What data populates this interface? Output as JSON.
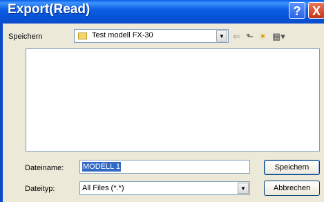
{
  "window": {
    "title": "Export(Read)"
  },
  "titlebar_buttons": {
    "help": "?",
    "close": "X"
  },
  "lookin": {
    "label": "Speichern",
    "value": "Test modell FX-30"
  },
  "toolbar": {
    "back": "⇐",
    "up": "⬑",
    "new_folder": "✶",
    "view_menu": "▦▾"
  },
  "filename": {
    "label": "Dateiname:",
    "value": "MODELL 1"
  },
  "filetype": {
    "label": "Dateityp:",
    "value": "All Files (*.*)"
  },
  "buttons": {
    "save": "Speichern",
    "cancel": "Abbrechen"
  }
}
